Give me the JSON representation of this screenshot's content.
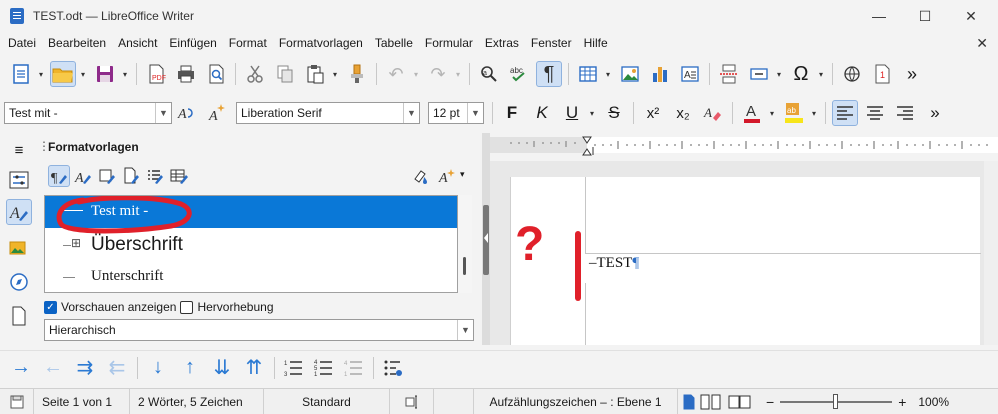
{
  "window": {
    "title": "TEST.odt — LibreOffice Writer",
    "minimize": "—",
    "maximize": "☐",
    "close": "✕"
  },
  "menu": [
    "Datei",
    "Bearbeiten",
    "Ansicht",
    "Einfügen",
    "Format",
    "Formatvorlagen",
    "Tabelle",
    "Formular",
    "Extras",
    "Fenster",
    "Hilfe"
  ],
  "menu_close": "✕",
  "formatting": {
    "paragraph_style": "Test mit -",
    "font_name": "Liberation Serif",
    "font_size": "12 pt",
    "bold": "F",
    "italic": "K",
    "underline": "U",
    "strike": "S",
    "superscript": "x²",
    "subscript": "x₂",
    "more": "»"
  },
  "sidebar": {
    "panel_title": "Formatvorlagen",
    "styles": [
      {
        "name": "Test mit -",
        "selected": true
      },
      {
        "name": "Überschrift",
        "selected": false
      },
      {
        "name": "Unterschrift",
        "selected": false
      }
    ],
    "expand_symbol": "⊞",
    "preview_label": "Vorschauen anzeigen",
    "preview_checked": true,
    "highlight_label": "Hervorhebung",
    "highlight_checked": false,
    "filter_value": "Hierarchisch"
  },
  "document": {
    "text": "–TEST",
    "pilcrow": "¶",
    "annotation_question": "?"
  },
  "statusbar": {
    "page": "Seite 1 von 1",
    "words": "2 Wörter, 5 Zeichen",
    "page_style": "Standard",
    "list_info": "Aufzählungszeichen – : Ebene 1",
    "zoom": "100%",
    "zoom_minus": "−",
    "zoom_plus": "+"
  },
  "colors": {
    "accent": "#0a78d7",
    "annotation_red": "#e0202a",
    "font_color_bar": "#d3182a",
    "highlight_bar": "#f7e51a"
  }
}
